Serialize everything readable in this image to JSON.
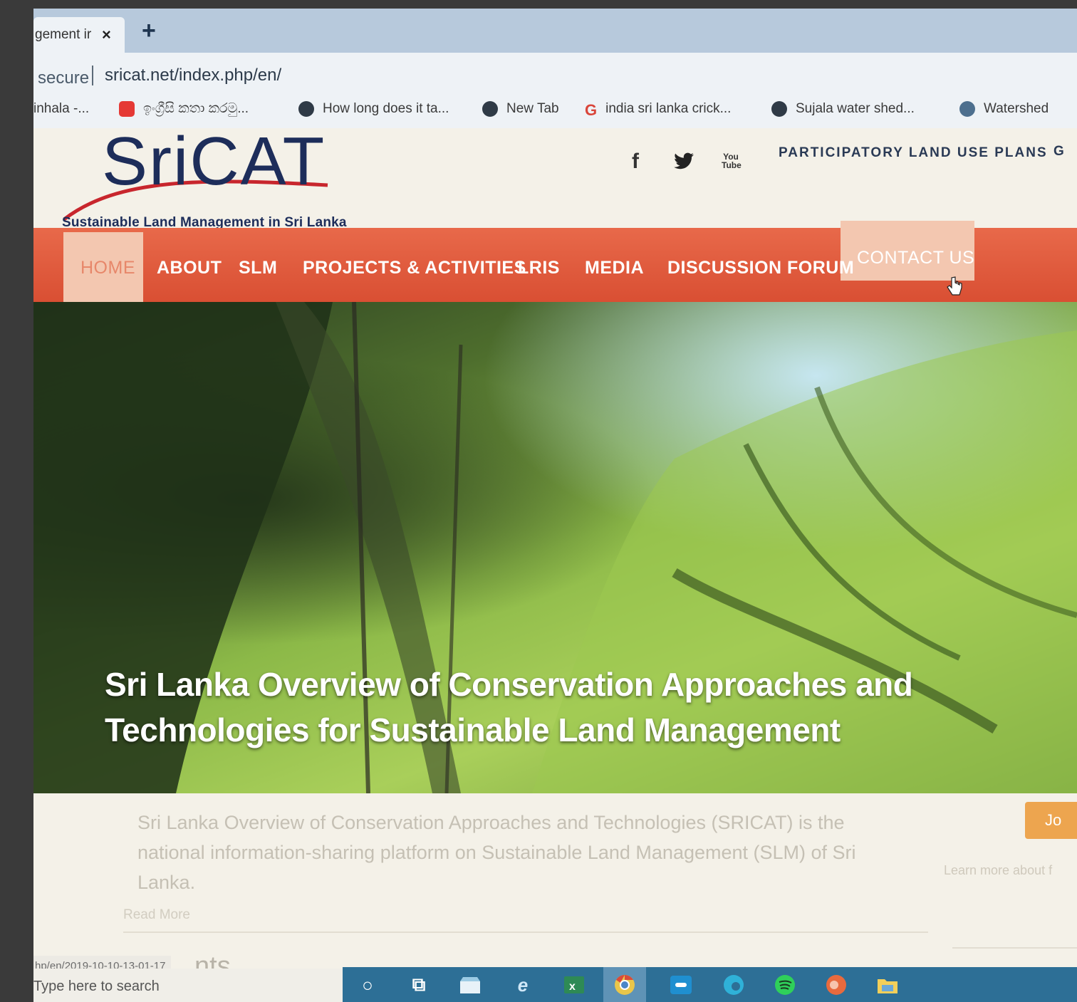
{
  "browser": {
    "tab": {
      "title": "gement ir",
      "close": "×"
    },
    "new_tab": "+",
    "address": {
      "security": "secure",
      "url": "sricat.net/index.php/en/"
    },
    "bookmarks": [
      {
        "label": "inhala -...",
        "icon": "none"
      },
      {
        "label": "ඉංග්‍රීසි කතා කරමු...",
        "icon": "youtube-icon"
      },
      {
        "label": "How long does it ta...",
        "icon": "globe-icon"
      },
      {
        "label": "New Tab",
        "icon": "globe-icon"
      },
      {
        "label": "india sri lanka crick...",
        "icon": "google-icon"
      },
      {
        "label": "Sujala water shed...",
        "icon": "globe-icon"
      },
      {
        "label": "Watershed",
        "icon": "site-icon"
      }
    ],
    "status_url": "hp/en/2019-10-10-13-01-17"
  },
  "site": {
    "logo": "SriCAT",
    "tagline": "Sustainable Land Management in Sri Lanka",
    "social": {
      "facebook": "f",
      "twitter": "🐦",
      "youtube": "You Tube"
    },
    "top_link": "PARTICIPATORY LAND USE PLANS",
    "top_link_cut": "G",
    "nav": [
      "HOME",
      "ABOUT",
      "SLM",
      "PROJECTS & ACTIVITIES",
      "LRIS",
      "MEDIA",
      "DISCUSSION FORUM",
      "CONTACT US"
    ],
    "hero_title": "Sri Lanka Overview of Conservation Approaches and Technologies for Sustainable Land Management",
    "intro": "Sri Lanka Overview of Conservation Approaches and Technologies (SRICAT) is the national information-sharing platform on Sustainable Land Management (SLM) of Sri Lanka.",
    "read_more": "Read More",
    "join_button": "Jo",
    "learn_more": "Learn more about f",
    "events_heading": "nts"
  },
  "taskbar": {
    "search_placeholder": "Type here to search",
    "icons": [
      "cortana-icon",
      "task-view-icon",
      "store-icon",
      "ie-icon",
      "excel-icon",
      "chrome-icon",
      "app-icon",
      "edge-icon",
      "spotify-icon",
      "powerpoint-icon",
      "file-explorer-icon"
    ]
  },
  "colors": {
    "nav_bg": "#e05c3f",
    "nav_active": "#f3c7b0",
    "logo": "#1d2d5a",
    "join_button": "#eda54f",
    "taskbar": "#2d6f96"
  }
}
